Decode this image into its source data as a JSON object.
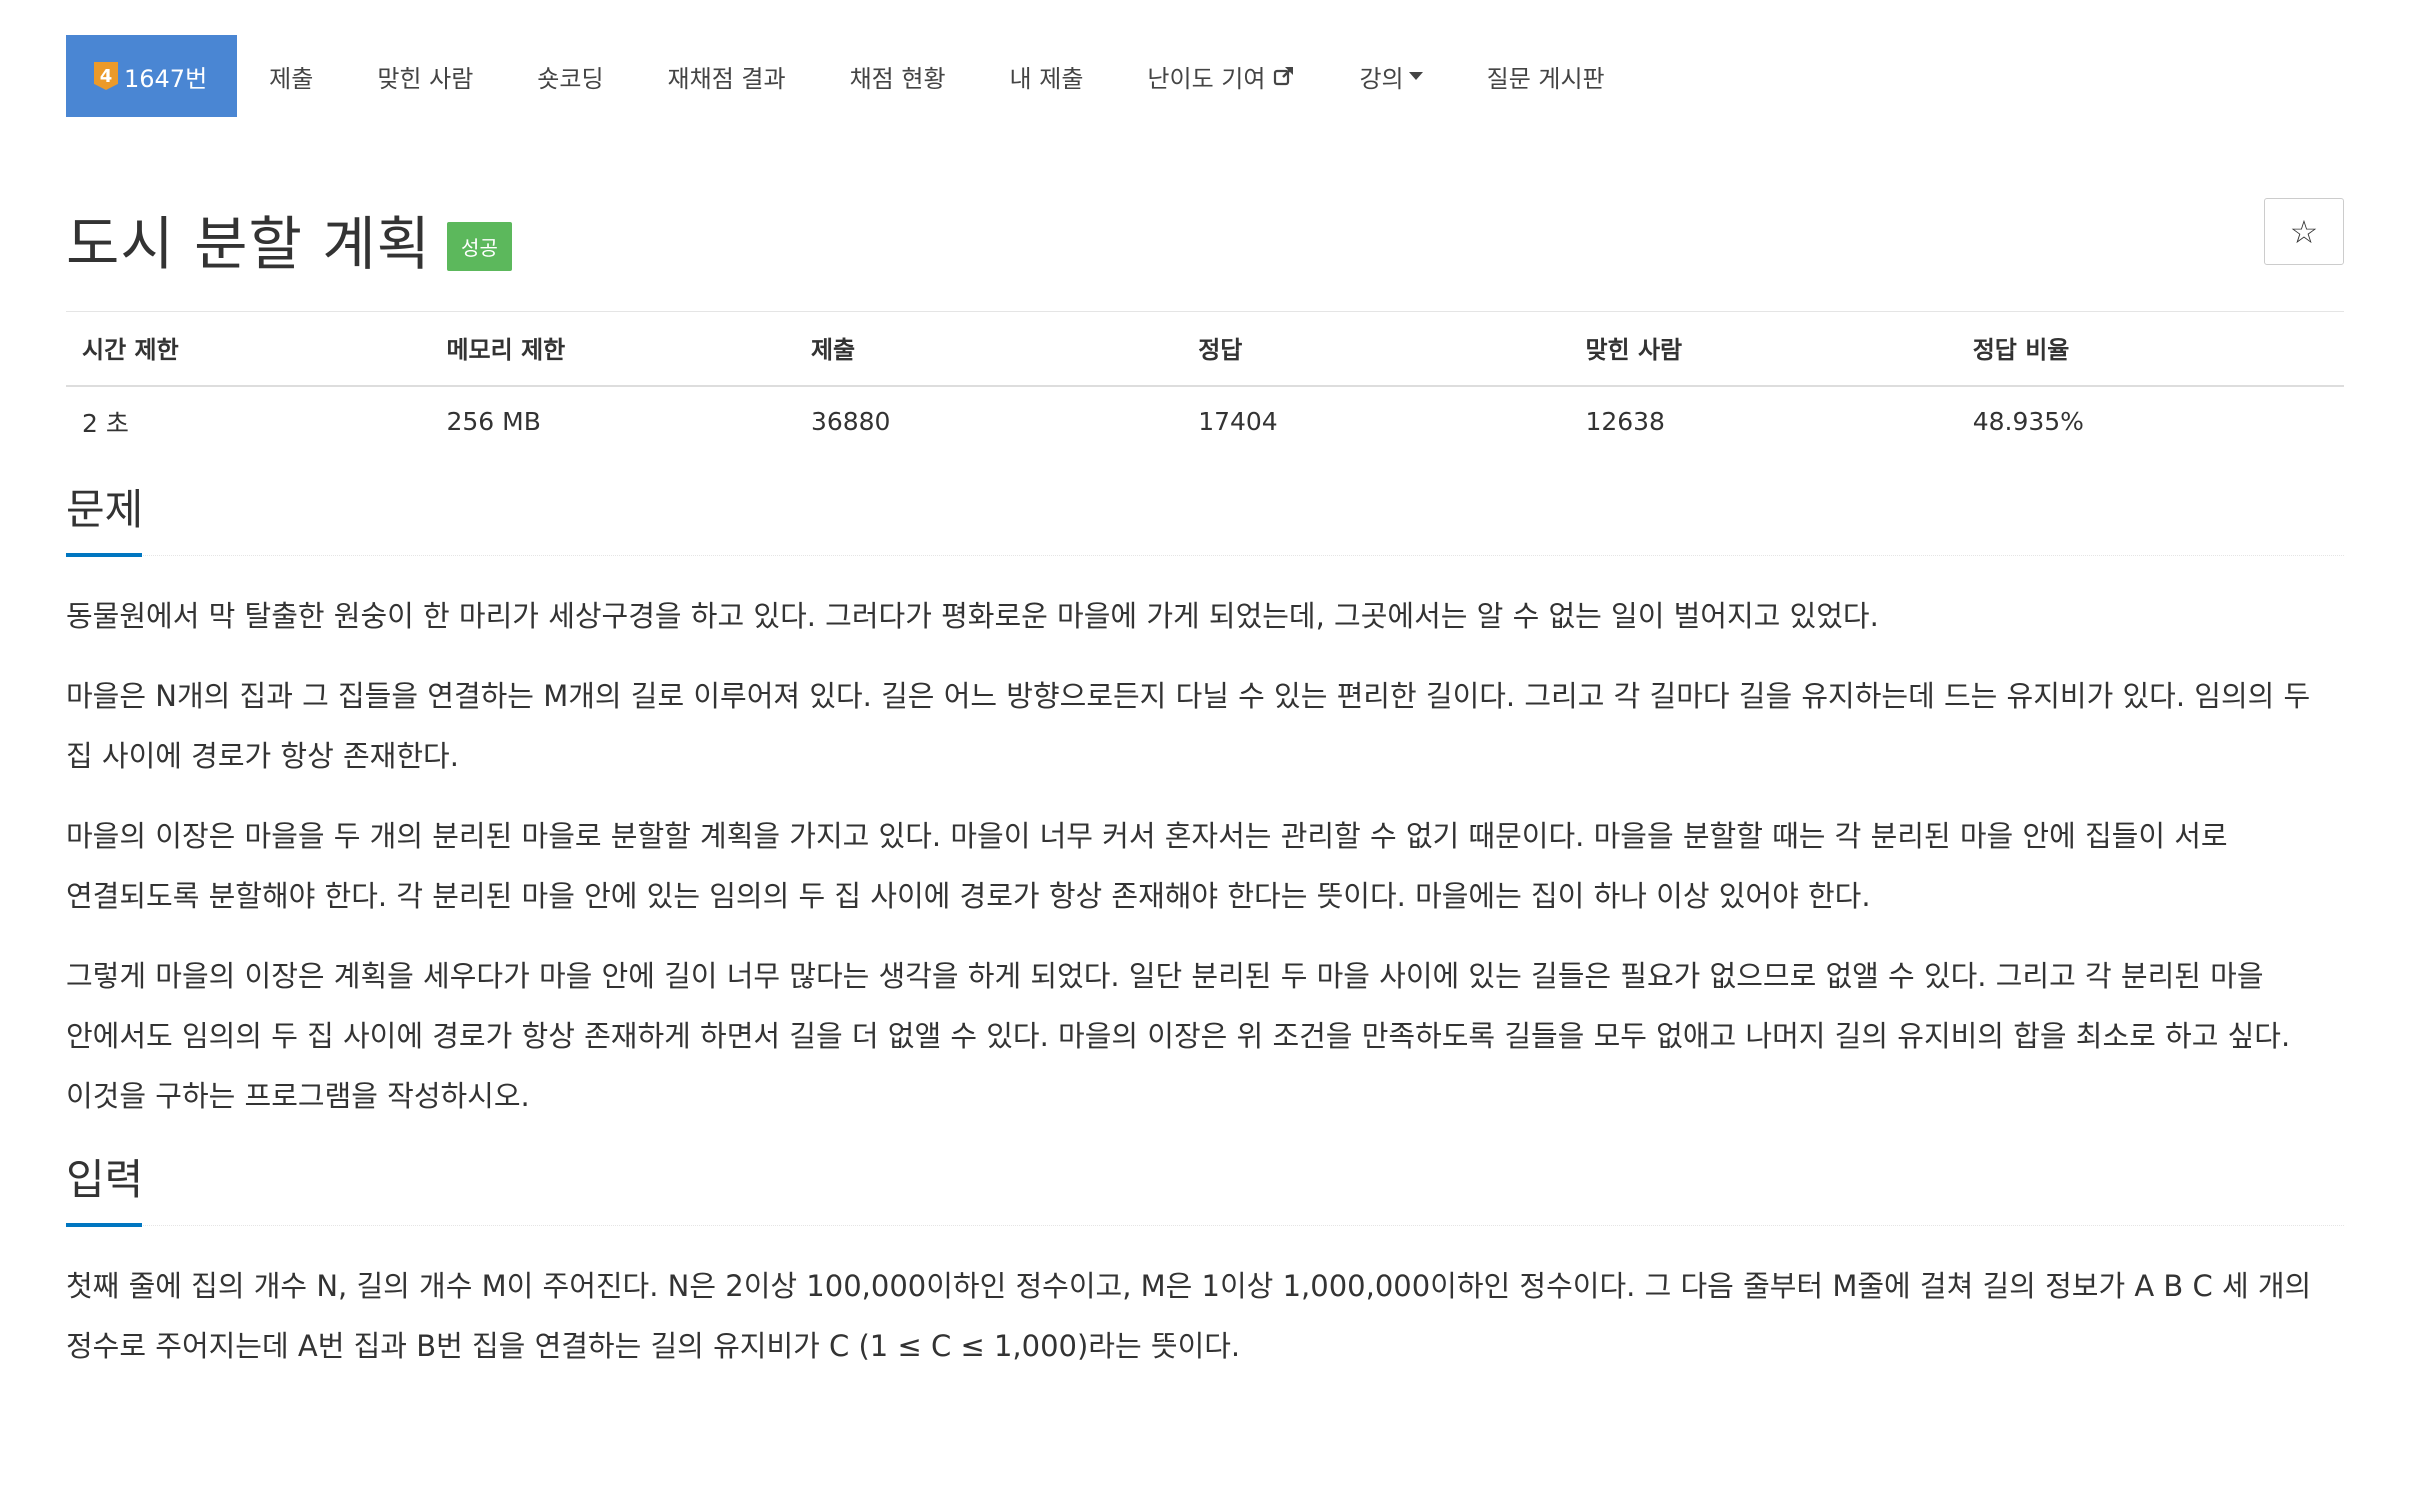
{
  "nav": {
    "problem_level": "4",
    "problem_number": "1647번",
    "items": [
      {
        "label": "제출"
      },
      {
        "label": "맞힌 사람"
      },
      {
        "label": "숏코딩"
      },
      {
        "label": "재채점 결과"
      },
      {
        "label": "채점 현황"
      },
      {
        "label": "내 제출"
      },
      {
        "label": "난이도 기여"
      },
      {
        "label": "강의"
      },
      {
        "label": "질문 게시판"
      }
    ]
  },
  "problem": {
    "title": "도시 분할 계획",
    "status": "성공",
    "star": "☆"
  },
  "info_table": {
    "headers": [
      "시간 제한",
      "메모리 제한",
      "제출",
      "정답",
      "맞힌 사람",
      "정답 비율"
    ],
    "values": [
      "2 초",
      "256 MB",
      "36880",
      "17404",
      "12638",
      "48.935%"
    ]
  },
  "sections": {
    "description": {
      "title": "문제",
      "paragraphs": [
        "동물원에서 막 탈출한 원숭이 한 마리가 세상구경을 하고 있다. 그러다가 평화로운 마을에 가게 되었는데, 그곳에서는 알 수 없는 일이 벌어지고 있었다.",
        "마을은 N개의 집과 그 집들을 연결하는 M개의 길로 이루어져 있다. 길은 어느 방향으로든지 다닐 수 있는 편리한 길이다. 그리고 각 길마다 길을 유지하는데 드는 유지비가 있다. 임의의 두 집 사이에 경로가 항상 존재한다.",
        "마을의 이장은 마을을 두 개의 분리된 마을로 분할할 계획을 가지고 있다. 마을이 너무 커서 혼자서는 관리할 수 없기 때문이다. 마을을 분할할 때는 각 분리된 마을 안에 집들이 서로 연결되도록 분할해야 한다. 각 분리된 마을 안에 있는 임의의 두 집 사이에 경로가 항상 존재해야 한다는 뜻이다. 마을에는 집이 하나 이상 있어야 한다.",
        "그렇게 마을의 이장은 계획을 세우다가 마을 안에 길이 너무 많다는 생각을 하게 되었다. 일단 분리된 두 마을 사이에 있는 길들은 필요가 없으므로 없앨 수 있다. 그리고 각 분리된 마을 안에서도 임의의 두 집 사이에 경로가 항상 존재하게 하면서 길을 더 없앨 수 있다. 마을의 이장은 위 조건을 만족하도록 길들을 모두 없애고 나머지 길의 유지비의 합을 최소로 하고 싶다. 이것을 구하는 프로그램을 작성하시오."
      ]
    },
    "input": {
      "title": "입력",
      "paragraphs": [
        "첫째 줄에 집의 개수 N, 길의 개수 M이 주어진다. N은 2이상 100,000이하인 정수이고, M은 1이상 1,000,000이하인 정수이다. 그 다음 줄부터 M줄에 걸쳐 길의 정보가 A B C 세 개의 정수로 주어지는데 A번 집과 B번 집을 연결하는 길의 유지비가 C (1 ≤ C ≤ 1,000)라는 뜻이다."
      ]
    }
  },
  "colors": {
    "active_tab": "#4a86d3",
    "level_badge": "#ec9a29",
    "success_label": "#5cb85c",
    "section_underline": "#0076c0"
  }
}
